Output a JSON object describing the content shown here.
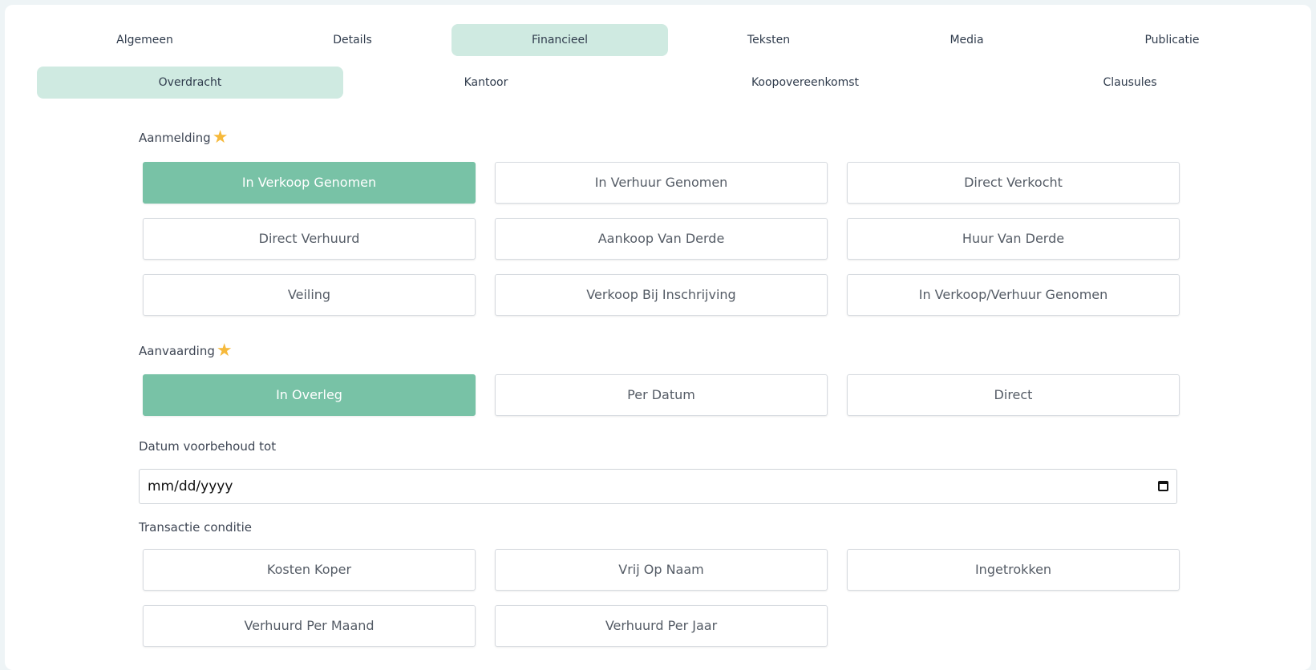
{
  "tabs_row1": [
    "Algemeen",
    "Details",
    "Financieel",
    "Teksten",
    "Media",
    "Publicatie"
  ],
  "tabs_row2": [
    "Overdracht",
    "Kantoor",
    "Koopovereenkomst",
    "Clausules"
  ],
  "aanmelding": {
    "label": "Aanmelding",
    "options": [
      "In Verkoop Genomen",
      "In Verhuur Genomen",
      "Direct Verkocht",
      "Direct Verhuurd",
      "Aankoop Van Derde",
      "Huur Van Derde",
      "Veiling",
      "Verkoop Bij Inschrijving",
      "In Verkoop/Verhuur Genomen"
    ]
  },
  "aanvaarding": {
    "label": "Aanvaarding",
    "options": [
      "In Overleg",
      "Per Datum",
      "Direct"
    ]
  },
  "datum": {
    "label": "Datum voorbehoud tot",
    "placeholder": "mm/dd/yyyy"
  },
  "transactie": {
    "label": "Transactie conditie",
    "options": [
      "Kosten Koper",
      "Vrij Op Naam",
      "Ingetrokken",
      "Verhuurd Per Maand",
      "Verhuurd Per Jaar"
    ]
  },
  "colors": {
    "accent": "#78c2a6",
    "tab_active": "#cfeae1",
    "star": "#f6b93b"
  }
}
